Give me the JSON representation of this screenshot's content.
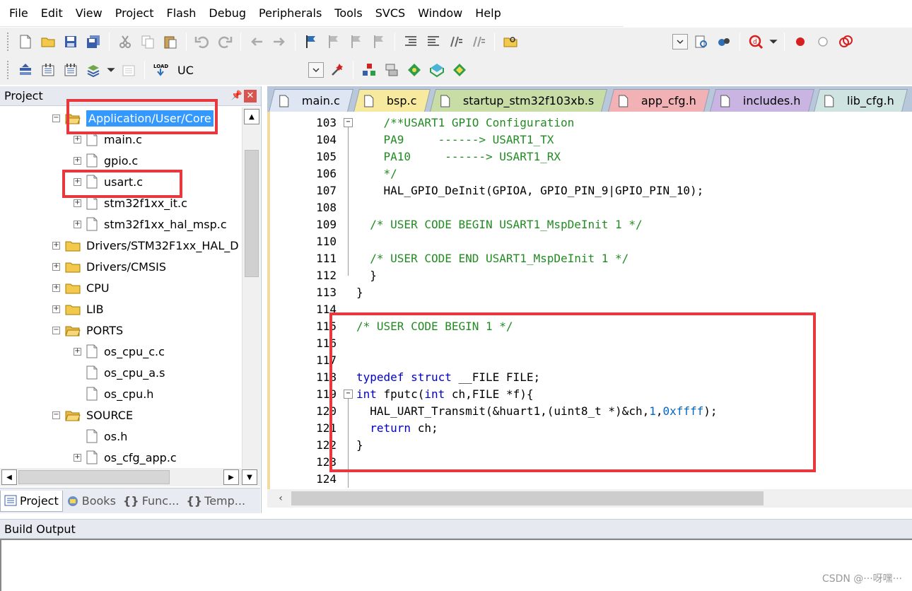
{
  "menu": [
    "File",
    "Edit",
    "View",
    "Project",
    "Flash",
    "Debug",
    "Peripherals",
    "Tools",
    "SVCS",
    "Window",
    "Help"
  ],
  "toolbar2": {
    "target": "UC"
  },
  "project_panel": {
    "title": "Project",
    "tree": [
      {
        "label": "Application/User/Core",
        "kind": "folder-open",
        "depth": 1,
        "expander": "−",
        "selected": true
      },
      {
        "label": "main.c",
        "kind": "file",
        "depth": 2,
        "expander": "+"
      },
      {
        "label": "gpio.c",
        "kind": "file",
        "depth": 2,
        "expander": "+"
      },
      {
        "label": "usart.c",
        "kind": "file",
        "depth": 2,
        "expander": "+"
      },
      {
        "label": "stm32f1xx_it.c",
        "kind": "file",
        "depth": 2,
        "expander": "+"
      },
      {
        "label": "stm32f1xx_hal_msp.c",
        "kind": "file",
        "depth": 2,
        "expander": "+"
      },
      {
        "label": "Drivers/STM32F1xx_HAL_D",
        "kind": "folder",
        "depth": 0,
        "expander": "+"
      },
      {
        "label": "Drivers/CMSIS",
        "kind": "folder",
        "depth": 0,
        "expander": "+"
      },
      {
        "label": "CPU",
        "kind": "folder",
        "depth": 0,
        "expander": "+"
      },
      {
        "label": "LIB",
        "kind": "folder",
        "depth": 0,
        "expander": "+"
      },
      {
        "label": "PORTS",
        "kind": "folder-open",
        "depth": 0,
        "expander": "−"
      },
      {
        "label": "os_cpu_c.c",
        "kind": "file",
        "depth": 1,
        "expander": "+"
      },
      {
        "label": "os_cpu_a.s",
        "kind": "file",
        "depth": 1,
        "expander": ""
      },
      {
        "label": "os_cpu.h",
        "kind": "file",
        "depth": 1,
        "expander": ""
      },
      {
        "label": "SOURCE",
        "kind": "folder-open",
        "depth": 0,
        "expander": "−"
      },
      {
        "label": "os.h",
        "kind": "file",
        "depth": 1,
        "expander": ""
      },
      {
        "label": "os_cfg_app.c",
        "kind": "file",
        "depth": 1,
        "expander": "+"
      }
    ],
    "bottom_tabs": [
      "Project",
      "Books",
      "Func...",
      "Temp..."
    ]
  },
  "editor_tabs": [
    {
      "label": "main.c",
      "color": "#dde6f2"
    },
    {
      "label": "bsp.c",
      "color": "#f7ea9e"
    },
    {
      "label": "startup_stm32f103xb.s",
      "color": "#c8dca6"
    },
    {
      "label": "app_cfg.h",
      "color": "#f2b1b5"
    },
    {
      "label": "includes.h",
      "color": "#c9b4e2"
    },
    {
      "label": "lib_cfg.h",
      "color": "#cfe3e0"
    }
  ],
  "code_lines": [
    {
      "n": "103",
      "fold": "−",
      "text": "    /**USART1 GPIO Configuration",
      "color": "green"
    },
    {
      "n": "104",
      "text": "    PA9     ------> USART1_TX",
      "color": "green"
    },
    {
      "n": "105",
      "text": "    PA10     ------> USART1_RX",
      "color": "green"
    },
    {
      "n": "106",
      "text": "    */",
      "color": "green"
    },
    {
      "n": "107",
      "text": "    HAL_GPIO_DeInit(GPIOA, GPIO_PIN_9|GPIO_PIN_10);",
      "color": "black"
    },
    {
      "n": "108",
      "text": "",
      "color": "black"
    },
    {
      "n": "109",
      "text": "  /* USER CODE BEGIN USART1_MspDeInit 1 */",
      "color": "green"
    },
    {
      "n": "110",
      "text": "",
      "color": "black"
    },
    {
      "n": "111",
      "text": "  /* USER CODE END USART1_MspDeInit 1 */",
      "color": "green"
    },
    {
      "n": "112",
      "text": "  }",
      "color": "black"
    },
    {
      "n": "113",
      "text": "}",
      "color": "black"
    },
    {
      "n": "114",
      "text": "",
      "color": "black"
    },
    {
      "n": "115",
      "text": "/* USER CODE BEGIN 1 */",
      "color": "green"
    },
    {
      "n": "116",
      "text": "",
      "color": "black"
    },
    {
      "n": "117",
      "text": "",
      "color": "black"
    },
    {
      "n": "118",
      "kw": "typedef struct",
      "text": " __FILE FILE;",
      "color": "black"
    },
    {
      "n": "119",
      "fold": "−",
      "kw": "int",
      "text": " fputc(",
      "kw2": "int",
      "text2": " ch,FILE *f){",
      "color": "black"
    },
    {
      "n": "120",
      "text": "  HAL_UART_Transmit(&huart1,(uint8_t *)&ch,",
      "num1": "1",
      "mid": ",",
      "num2": "0xffff",
      "tail": ");",
      "color": "black"
    },
    {
      "n": "121",
      "kw": "  return",
      "text": " ch;",
      "color": "black"
    },
    {
      "n": "122",
      "text": "}",
      "color": "black"
    },
    {
      "n": "123",
      "text": "",
      "color": "black"
    },
    {
      "n": "124",
      "text": "",
      "color": "black"
    }
  ],
  "build_output": {
    "title": "Build Output"
  },
  "watermark": "CSDN @···呀嘿···"
}
